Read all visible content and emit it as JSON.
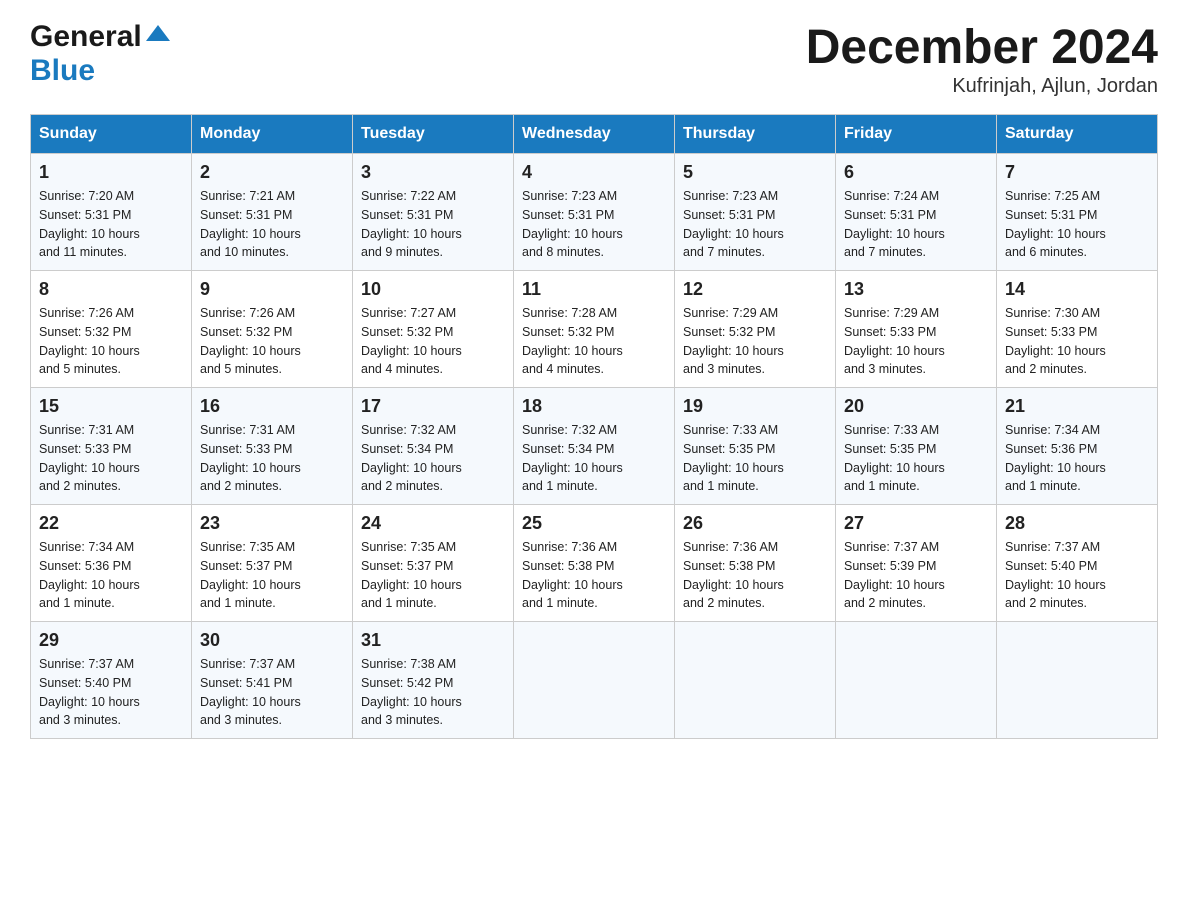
{
  "header": {
    "logo_general": "General",
    "logo_blue": "Blue",
    "title": "December 2024",
    "location": "Kufrinjah, Ajlun, Jordan"
  },
  "days_of_week": [
    "Sunday",
    "Monday",
    "Tuesday",
    "Wednesday",
    "Thursday",
    "Friday",
    "Saturday"
  ],
  "weeks": [
    [
      {
        "day": "1",
        "sunrise": "7:20 AM",
        "sunset": "5:31 PM",
        "daylight": "10 hours and 11 minutes."
      },
      {
        "day": "2",
        "sunrise": "7:21 AM",
        "sunset": "5:31 PM",
        "daylight": "10 hours and 10 minutes."
      },
      {
        "day": "3",
        "sunrise": "7:22 AM",
        "sunset": "5:31 PM",
        "daylight": "10 hours and 9 minutes."
      },
      {
        "day": "4",
        "sunrise": "7:23 AM",
        "sunset": "5:31 PM",
        "daylight": "10 hours and 8 minutes."
      },
      {
        "day": "5",
        "sunrise": "7:23 AM",
        "sunset": "5:31 PM",
        "daylight": "10 hours and 7 minutes."
      },
      {
        "day": "6",
        "sunrise": "7:24 AM",
        "sunset": "5:31 PM",
        "daylight": "10 hours and 7 minutes."
      },
      {
        "day": "7",
        "sunrise": "7:25 AM",
        "sunset": "5:31 PM",
        "daylight": "10 hours and 6 minutes."
      }
    ],
    [
      {
        "day": "8",
        "sunrise": "7:26 AM",
        "sunset": "5:32 PM",
        "daylight": "10 hours and 5 minutes."
      },
      {
        "day": "9",
        "sunrise": "7:26 AM",
        "sunset": "5:32 PM",
        "daylight": "10 hours and 5 minutes."
      },
      {
        "day": "10",
        "sunrise": "7:27 AM",
        "sunset": "5:32 PM",
        "daylight": "10 hours and 4 minutes."
      },
      {
        "day": "11",
        "sunrise": "7:28 AM",
        "sunset": "5:32 PM",
        "daylight": "10 hours and 4 minutes."
      },
      {
        "day": "12",
        "sunrise": "7:29 AM",
        "sunset": "5:32 PM",
        "daylight": "10 hours and 3 minutes."
      },
      {
        "day": "13",
        "sunrise": "7:29 AM",
        "sunset": "5:33 PM",
        "daylight": "10 hours and 3 minutes."
      },
      {
        "day": "14",
        "sunrise": "7:30 AM",
        "sunset": "5:33 PM",
        "daylight": "10 hours and 2 minutes."
      }
    ],
    [
      {
        "day": "15",
        "sunrise": "7:31 AM",
        "sunset": "5:33 PM",
        "daylight": "10 hours and 2 minutes."
      },
      {
        "day": "16",
        "sunrise": "7:31 AM",
        "sunset": "5:33 PM",
        "daylight": "10 hours and 2 minutes."
      },
      {
        "day": "17",
        "sunrise": "7:32 AM",
        "sunset": "5:34 PM",
        "daylight": "10 hours and 2 minutes."
      },
      {
        "day": "18",
        "sunrise": "7:32 AM",
        "sunset": "5:34 PM",
        "daylight": "10 hours and 1 minute."
      },
      {
        "day": "19",
        "sunrise": "7:33 AM",
        "sunset": "5:35 PM",
        "daylight": "10 hours and 1 minute."
      },
      {
        "day": "20",
        "sunrise": "7:33 AM",
        "sunset": "5:35 PM",
        "daylight": "10 hours and 1 minute."
      },
      {
        "day": "21",
        "sunrise": "7:34 AM",
        "sunset": "5:36 PM",
        "daylight": "10 hours and 1 minute."
      }
    ],
    [
      {
        "day": "22",
        "sunrise": "7:34 AM",
        "sunset": "5:36 PM",
        "daylight": "10 hours and 1 minute."
      },
      {
        "day": "23",
        "sunrise": "7:35 AM",
        "sunset": "5:37 PM",
        "daylight": "10 hours and 1 minute."
      },
      {
        "day": "24",
        "sunrise": "7:35 AM",
        "sunset": "5:37 PM",
        "daylight": "10 hours and 1 minute."
      },
      {
        "day": "25",
        "sunrise": "7:36 AM",
        "sunset": "5:38 PM",
        "daylight": "10 hours and 1 minute."
      },
      {
        "day": "26",
        "sunrise": "7:36 AM",
        "sunset": "5:38 PM",
        "daylight": "10 hours and 2 minutes."
      },
      {
        "day": "27",
        "sunrise": "7:37 AM",
        "sunset": "5:39 PM",
        "daylight": "10 hours and 2 minutes."
      },
      {
        "day": "28",
        "sunrise": "7:37 AM",
        "sunset": "5:40 PM",
        "daylight": "10 hours and 2 minutes."
      }
    ],
    [
      {
        "day": "29",
        "sunrise": "7:37 AM",
        "sunset": "5:40 PM",
        "daylight": "10 hours and 3 minutes."
      },
      {
        "day": "30",
        "sunrise": "7:37 AM",
        "sunset": "5:41 PM",
        "daylight": "10 hours and 3 minutes."
      },
      {
        "day": "31",
        "sunrise": "7:38 AM",
        "sunset": "5:42 PM",
        "daylight": "10 hours and 3 minutes."
      },
      {
        "day": "",
        "sunrise": "",
        "sunset": "",
        "daylight": ""
      },
      {
        "day": "",
        "sunrise": "",
        "sunset": "",
        "daylight": ""
      },
      {
        "day": "",
        "sunrise": "",
        "sunset": "",
        "daylight": ""
      },
      {
        "day": "",
        "sunrise": "",
        "sunset": "",
        "daylight": ""
      }
    ]
  ],
  "labels": {
    "sunrise": "Sunrise:",
    "sunset": "Sunset:",
    "daylight": "Daylight:"
  }
}
